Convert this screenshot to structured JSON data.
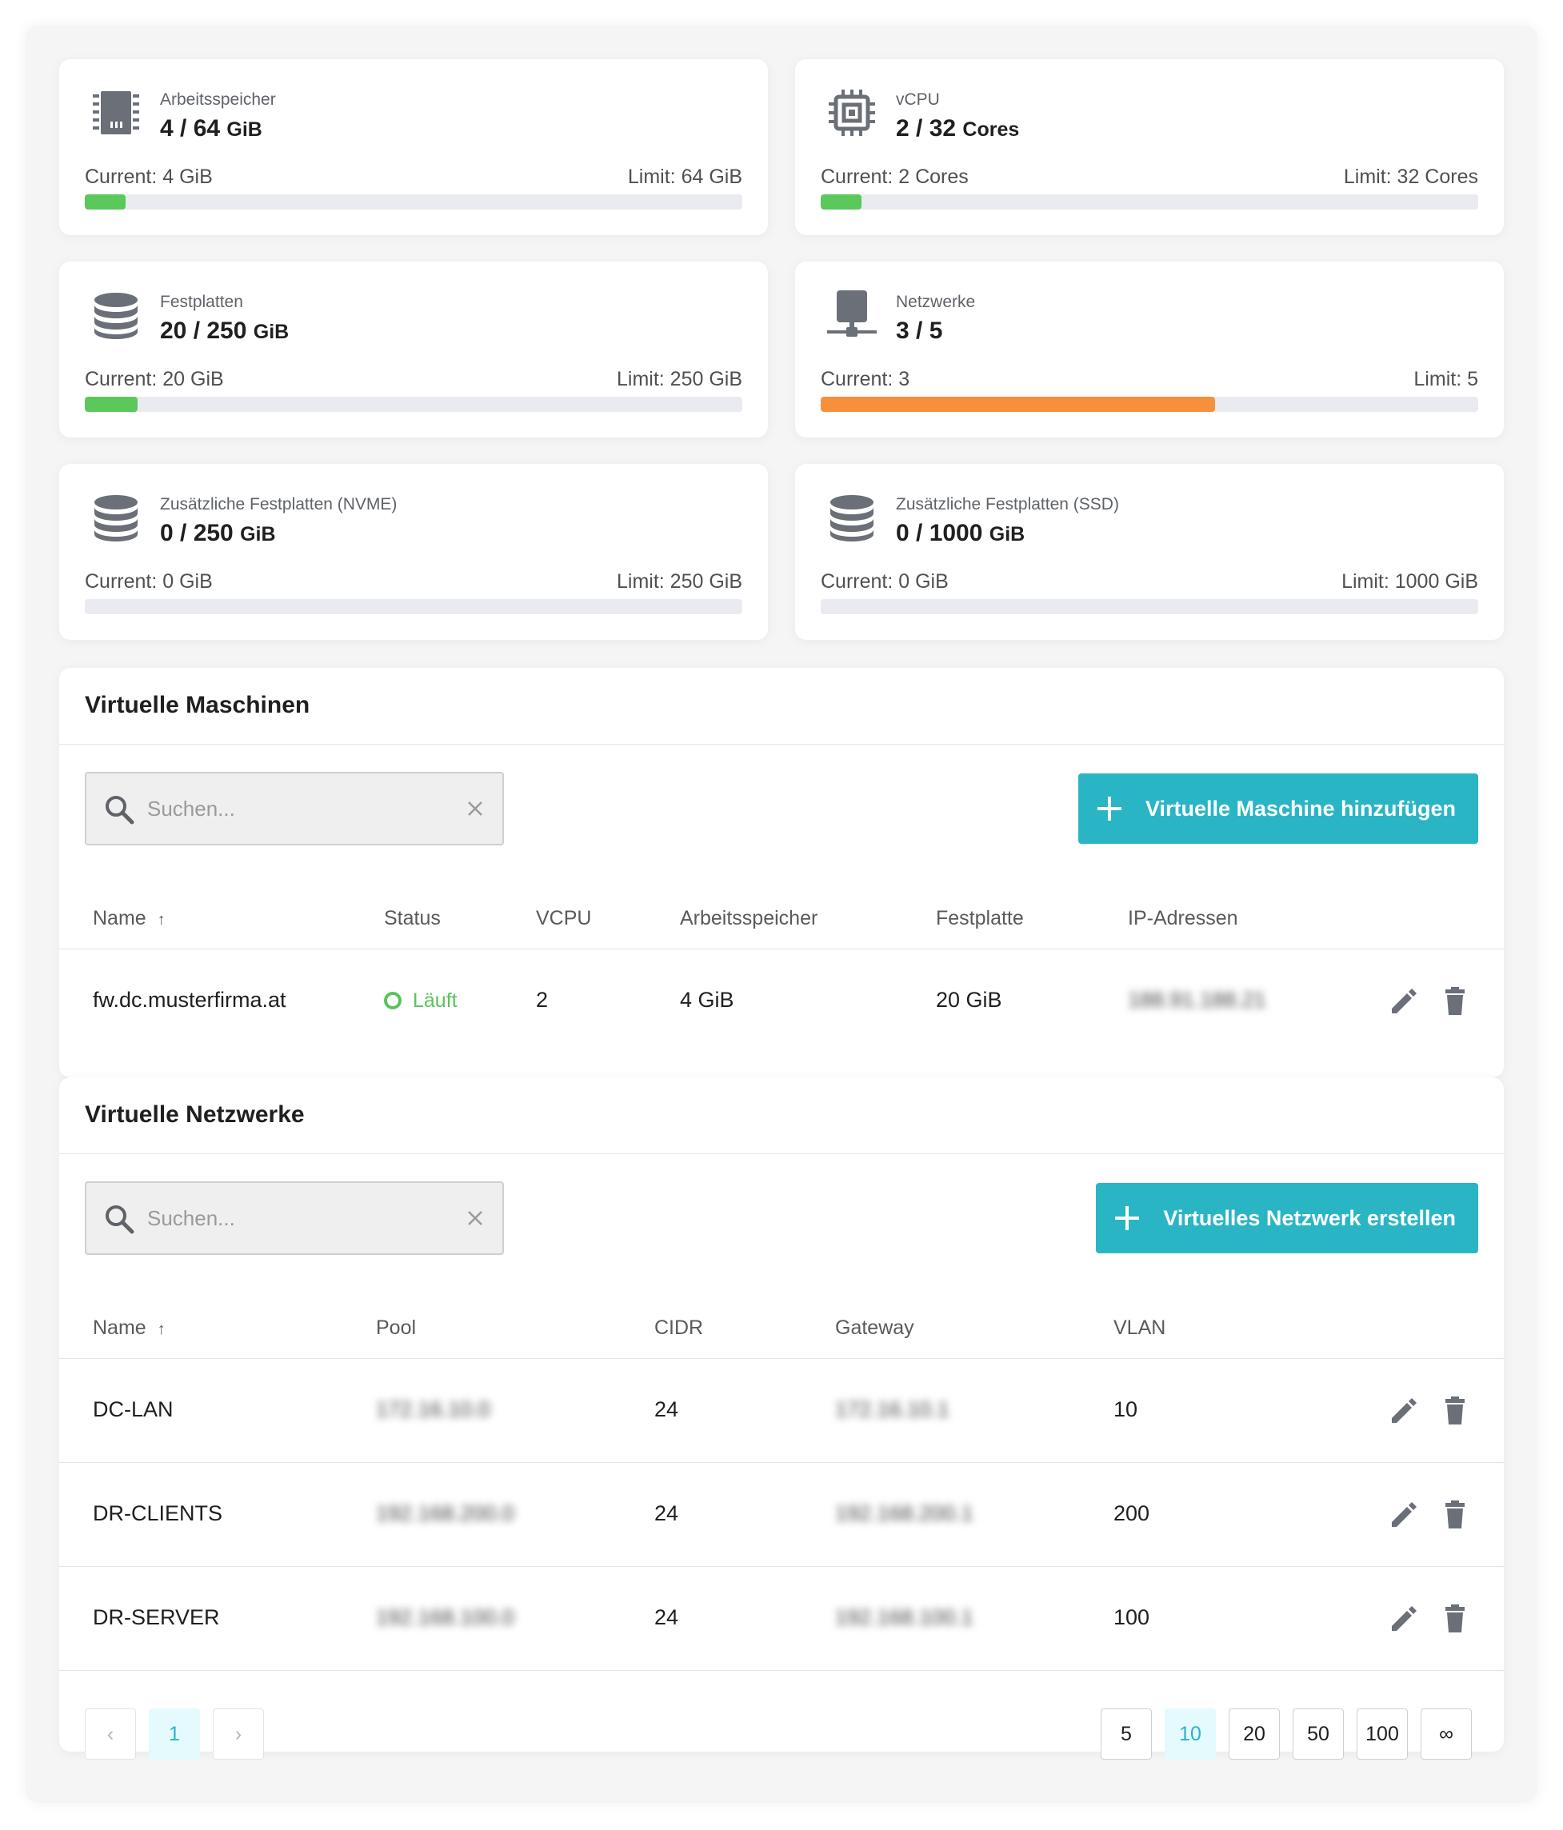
{
  "resources": [
    {
      "label": "Arbeitsspeicher",
      "value": "4 / 64",
      "unit": "GiB",
      "current": "Current: 4 GiB",
      "limit": "Limit: 64 GiB",
      "fraction": 0.0625,
      "color": "#5ac85a",
      "icon": "memory-chip-icon"
    },
    {
      "label": "vCPU",
      "value": "2 / 32",
      "unit": "Cores",
      "current": "Current: 2 Cores",
      "limit": "Limit: 32 Cores",
      "fraction": 0.0625,
      "color": "#5ac85a",
      "icon": "cpu-icon"
    },
    {
      "label": "Festplatten",
      "value": "20 / 250",
      "unit": "GiB",
      "current": "Current: 20 GiB",
      "limit": "Limit: 250 GiB",
      "fraction": 0.08,
      "color": "#5ac85a",
      "icon": "database-icon"
    },
    {
      "label": "Netzwerke",
      "value": "3 / 5",
      "unit": "",
      "current": "Current: 3",
      "limit": "Limit: 5",
      "fraction": 0.6,
      "color": "#f7903a",
      "icon": "network-icon"
    },
    {
      "label": "Zusätzliche Festplatten (NVME)",
      "value": "0 / 250",
      "unit": "GiB",
      "current": "Current: 0 GiB",
      "limit": "Limit: 250 GiB",
      "fraction": 0,
      "color": "#5ac85a",
      "icon": "database-icon"
    },
    {
      "label": "Zusätzliche Festplatten (SSD)",
      "value": "0 / 1000",
      "unit": "GiB",
      "current": "Current: 0 GiB",
      "limit": "Limit: 1000 GiB",
      "fraction": 0,
      "color": "#5ac85a",
      "icon": "database-icon"
    }
  ],
  "vms": {
    "title": "Virtuelle Maschinen",
    "search_placeholder": "Suchen...",
    "add_label": "Virtuelle Maschine hinzufügen",
    "columns": [
      "Name",
      "Status",
      "VCPU",
      "Arbeitsspeicher",
      "Festplatte",
      "IP-Adressen"
    ],
    "sort_arrow": "↑",
    "rows": [
      {
        "name": "fw.dc.musterfirma.at",
        "status": "Läuft",
        "vcpu": "2",
        "ram": "4 GiB",
        "disk": "20 GiB",
        "ip": "188.91.188.21"
      }
    ]
  },
  "nets": {
    "title": "Virtuelle Netzwerke",
    "search_placeholder": "Suchen...",
    "add_label": "Virtuelles Netzwerk erstellen",
    "columns": [
      "Name",
      "Pool",
      "CIDR",
      "Gateway",
      "VLAN"
    ],
    "sort_arrow": "↑",
    "rows": [
      {
        "name": "DC-LAN",
        "pool": "172.16.10.0",
        "cidr": "24",
        "gateway": "172.16.10.1",
        "vlan": "10"
      },
      {
        "name": "DR-CLIENTS",
        "pool": "192.168.200.0",
        "cidr": "24",
        "gateway": "192.168.200.1",
        "vlan": "200"
      },
      {
        "name": "DR-SERVER",
        "pool": "192.168.100.0",
        "cidr": "24",
        "gateway": "192.168.100.1",
        "vlan": "100"
      }
    ]
  },
  "pagination": {
    "prev": "‹",
    "next": "›",
    "current_page": "1",
    "sizes": [
      "5",
      "10",
      "20",
      "50",
      "100",
      "∞"
    ],
    "active_size": "10"
  }
}
